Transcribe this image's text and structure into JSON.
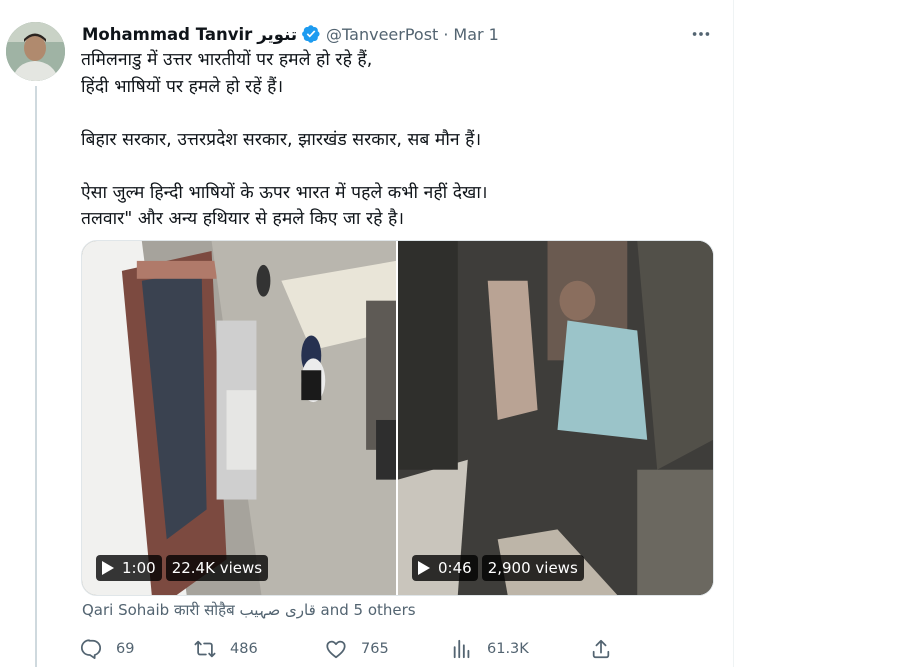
{
  "tweet": {
    "display_name": "Mohammad Tanvir",
    "display_name_script": "تنویر",
    "handle": "@TanveerPost",
    "separator": "·",
    "date": "Mar 1",
    "lines": [
      "तमिलनाडु में उत्तर भारतीयों पर हमले हो रहे हैं,",
      "हिंदी भाषियों पर हमले हो रहें हैं।",
      "बिहार सरकार, उत्तरप्रदेश सरकार, झारखंड सरकार, सब मौन हैं।",
      "ऐसा जुल्म हिन्दी भाषियों के ऊपर भारत में पहले कभी नहीं देखा।",
      "तलवार\" और अन्य हथियार से हमले किए जा रहे है।"
    ]
  },
  "media": {
    "videos": [
      {
        "duration": "1:00",
        "views": "22.4K views"
      },
      {
        "duration": "0:46",
        "views": "2,900 views"
      }
    ]
  },
  "liked_by": "Qari Sohaib कारी सोहैब قاری صہیب and 5 others",
  "actions": {
    "reply_count": "69",
    "retweet_count": "486",
    "like_count": "765",
    "view_count": "61.3K"
  },
  "icons": [
    "verified-badge-icon",
    "more-icon",
    "play-icon",
    "reply-icon",
    "retweet-icon",
    "like-icon",
    "views-icon",
    "share-icon"
  ],
  "colors": {
    "verified": "#1d9bf0",
    "secondary_text": "#536471",
    "text": "#0f1419"
  }
}
